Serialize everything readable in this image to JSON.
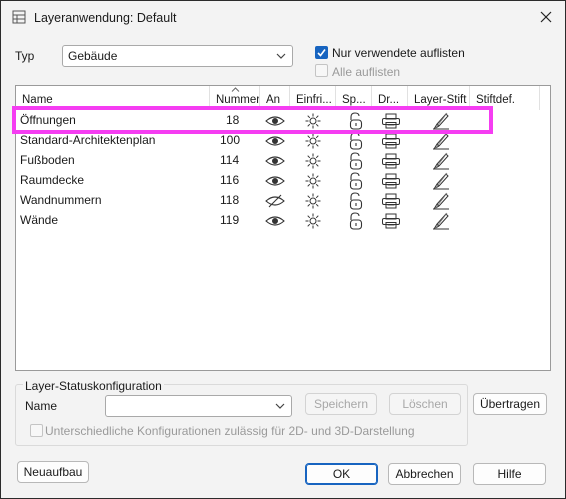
{
  "window": {
    "title": "Layeranwendung: Default",
    "close_icon": "close-icon"
  },
  "typ": {
    "label": "Typ",
    "value": "Gebäude"
  },
  "options": {
    "only_used": {
      "label": "Nur verwendete auflisten",
      "checked": true
    },
    "list_all": {
      "label": "Alle auflisten",
      "checked": false,
      "enabled": false
    }
  },
  "table": {
    "columns": [
      "Name",
      "Nummer",
      "An",
      "Einfri...",
      "Sp...",
      "Dr...",
      "Layer-Stift",
      "Stiftdef."
    ],
    "rows": [
      {
        "name": "Öffnungen",
        "number": "18",
        "visible": true
      },
      {
        "name": "Standard-Architektenplan",
        "number": "100",
        "visible": true
      },
      {
        "name": "Fußboden",
        "number": "114",
        "visible": true
      },
      {
        "name": "Raumdecke",
        "number": "116",
        "visible": true
      },
      {
        "name": "Wandnummern",
        "number": "118",
        "visible": false
      },
      {
        "name": "Wände",
        "number": "119",
        "visible": true
      }
    ]
  },
  "layer_status": {
    "group_label": "Layer-Statuskonfiguration",
    "name_label": "Name",
    "name_value": "",
    "save_label": "Speichern",
    "delete_label": "Löschen",
    "transfer_label": "Übertragen",
    "different_configs_label": "Unterschiedliche Konfigurationen zulässig für 2D- und 3D-Darstellung"
  },
  "footer": {
    "rebuild_label": "Neuaufbau",
    "ok_label": "OK",
    "cancel_label": "Abbrechen",
    "help_label": "Hilfe"
  },
  "colors": {
    "highlight": "#f53df2",
    "accent": "#1764c0"
  }
}
